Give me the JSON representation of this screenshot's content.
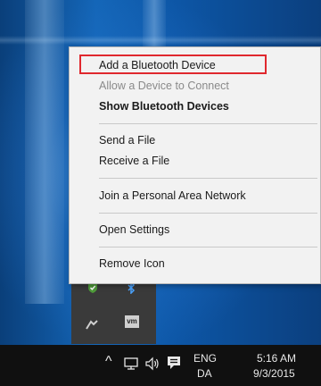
{
  "context_menu": {
    "items": [
      {
        "label": "Add a Bluetooth Device",
        "state": "highlighted"
      },
      {
        "label": "Allow a Device to Connect",
        "state": "disabled"
      },
      {
        "label": "Show Bluetooth Devices",
        "state": "bold"
      },
      {
        "label": "Send a File",
        "state": "normal"
      },
      {
        "label": "Receive a File",
        "state": "normal"
      },
      {
        "label": "Join a Personal Area Network",
        "state": "normal"
      },
      {
        "label": "Open Settings",
        "state": "normal"
      },
      {
        "label": "Remove Icon",
        "state": "normal"
      }
    ],
    "highlight_color": "#e0282e"
  },
  "tray_overflow": {
    "icons": [
      "shield-check-icon",
      "bluetooth-icon",
      "network-share-icon",
      "vm-icon"
    ],
    "vm_label": "vm"
  },
  "taskbar": {
    "chevron_glyph": "^",
    "language_line1": "ENG",
    "language_line2": "DA",
    "time": "5:16 AM",
    "date": "9/3/2015"
  }
}
